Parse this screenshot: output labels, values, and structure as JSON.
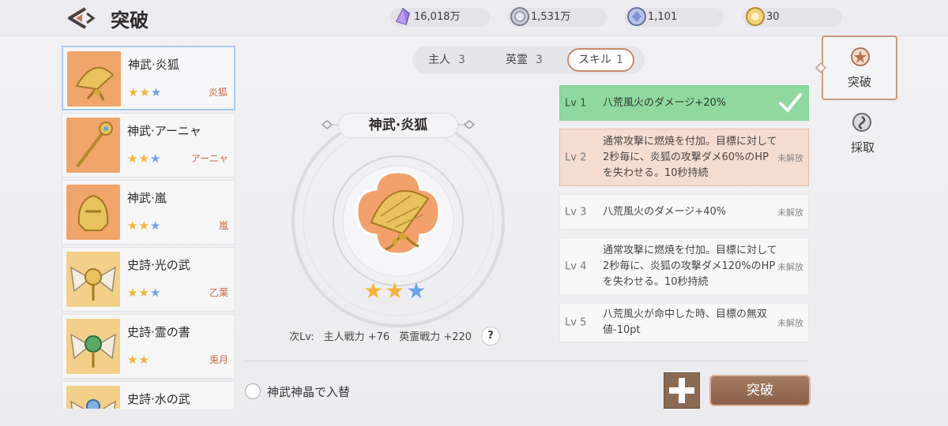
{
  "header": {
    "title": "突破",
    "currencies": [
      {
        "icon": "purple-crystal-icon",
        "value": "16,018万"
      },
      {
        "icon": "silver-coin-icon",
        "value": "1,531万"
      },
      {
        "icon": "blue-gem-icon",
        "value": "1,101"
      },
      {
        "icon": "gold-medal-icon",
        "value": "30"
      }
    ]
  },
  "list": {
    "items": [
      {
        "name": "神武·炎狐",
        "stars": [
          "gold",
          "gold",
          "blue"
        ],
        "owner": "炎狐",
        "icon": "golden-fan-icon"
      },
      {
        "name": "神武·アーニャ",
        "stars": [
          "gold",
          "gold",
          "blue"
        ],
        "owner": "アーニャ",
        "icon": "golden-staff-icon"
      },
      {
        "name": "神武·嵐",
        "stars": [
          "gold",
          "gold",
          "blue"
        ],
        "owner": "嵐",
        "icon": "golden-helmet-icon"
      },
      {
        "name": "史詩·光の武",
        "stars": [
          "gold",
          "gold",
          "blue"
        ],
        "owner": "乙葉",
        "icon": "winged-crest-icon"
      },
      {
        "name": "史詩·霊の書",
        "stars": [
          "gold",
          "gold"
        ],
        "owner": "兎月",
        "icon": "winged-crest-green-icon"
      },
      {
        "name": "史詩·水の武",
        "stars": [],
        "owner": "",
        "icon": "winged-crest-blue-icon"
      }
    ]
  },
  "tabs": [
    {
      "label": "主人",
      "count": "3"
    },
    {
      "label": "英霊",
      "count": "3"
    },
    {
      "label": "スキル",
      "count": "1"
    }
  ],
  "detail": {
    "title": "神武·炎狐",
    "stars": [
      "gold",
      "gold",
      "blue"
    ],
    "next_label": "次Lv:",
    "master_power": "主人戦力 +76",
    "spirit_power": "英霊戦力 +220",
    "help": "?"
  },
  "levels": [
    {
      "lv": "Lv 1",
      "desc": "八荒風火のダメージ+20%",
      "status": "",
      "state": "done"
    },
    {
      "lv": "Lv 2",
      "desc": "通常攻撃に燃焼を付加。目標に対して2秒毎に、炎狐の攻撃ダメ60%のHPを失わせる。10秒持続",
      "status": "未解放",
      "state": "next"
    },
    {
      "lv": "Lv 3",
      "desc": "八荒風火のダメージ+40%",
      "status": "未解放",
      "state": "locked"
    },
    {
      "lv": "Lv 4",
      "desc": "通常攻撃に燃焼を付加。目標に対して2秒毎に、炎狐の攻撃ダメ120%のHPを失わせる。10秒持続",
      "status": "未解放",
      "state": "locked"
    },
    {
      "lv": "Lv 5",
      "desc": "八荒風火が命中した時、目標の無双値-10pt",
      "status": "未解放",
      "state": "locked"
    }
  ],
  "footer": {
    "replace_label": "神武神晶で入替",
    "break_label": "突破"
  },
  "side_nav": [
    {
      "label": "突破",
      "icon": "star-badge-icon"
    },
    {
      "label": "採取",
      "icon": "swirl-badge-icon"
    }
  ],
  "colors": {
    "accent": "#c98a6c",
    "done_green": "#8fd9a0",
    "next_peach": "#f4ddcf",
    "star_gold": "#f2b53b",
    "star_blue": "#6aa4ef"
  }
}
